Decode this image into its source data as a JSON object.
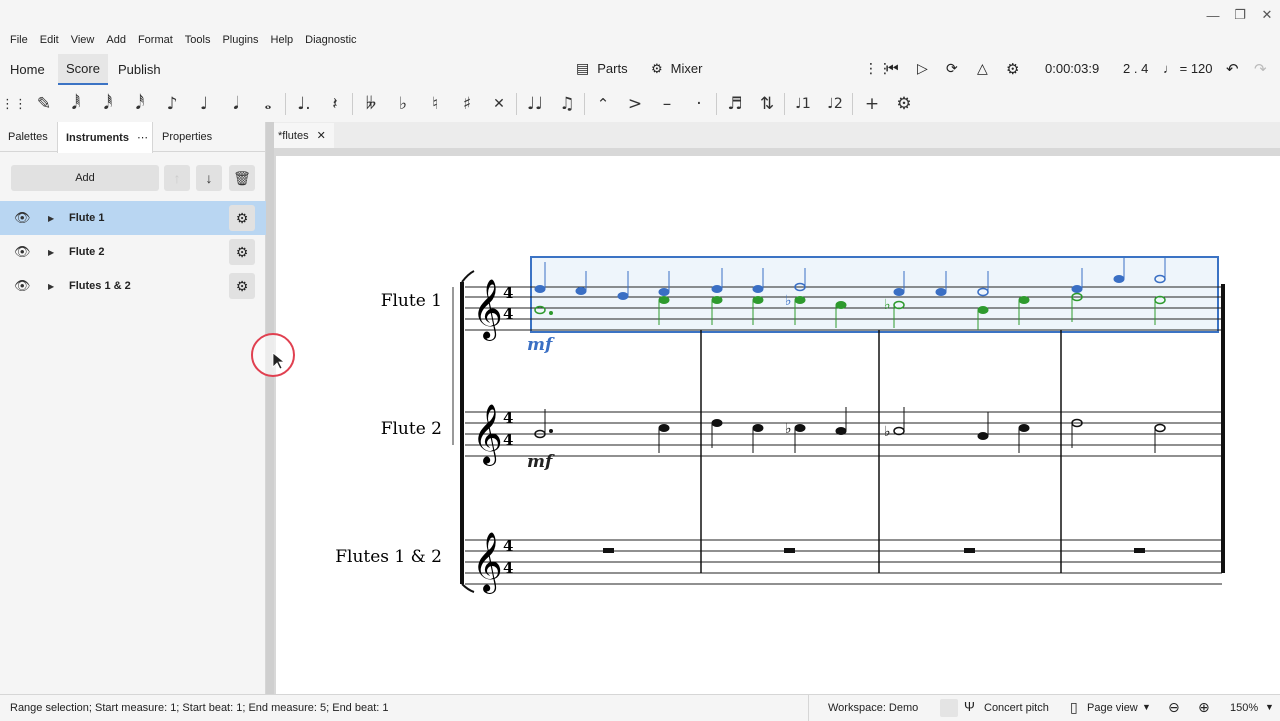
{
  "menu": [
    "File",
    "Edit",
    "View",
    "Add",
    "Format",
    "Tools",
    "Plugins",
    "Help",
    "Diagnostic"
  ],
  "tabs": {
    "home": "Home",
    "score": "Score",
    "publish": "Publish"
  },
  "tabbar": {
    "parts": "Parts",
    "mixer": "Mixer",
    "time": "0:00:03:9",
    "position": "2 . 4",
    "tempo": "♩ = 120"
  },
  "panel": {
    "tabs": {
      "palettes": "Palettes",
      "instruments": "Instruments",
      "properties": "Properties"
    },
    "add": "Add",
    "instruments": [
      {
        "name": "Flute 1",
        "selected": true
      },
      {
        "name": "Flute 2",
        "selected": false
      },
      {
        "name": "Flutes 1 & 2",
        "selected": false
      }
    ]
  },
  "document": {
    "tab": "*flutes"
  },
  "score": {
    "staves": [
      "Flute 1",
      "Flute 2",
      "Flutes 1 & 2"
    ],
    "dynamic": "mf",
    "time_signature": "4/4"
  },
  "status": {
    "selection": "Range selection; Start measure: 1; Start beat: 1; End measure: 5; End beat: 1",
    "workspace": "Workspace: Demo",
    "concert_pitch": "Concert pitch",
    "view_mode": "Page view",
    "zoom": "150%"
  },
  "colors": {
    "accent": "#3b73c4",
    "voice1": "#3a6fc4",
    "voice2": "#2e9a2e",
    "selection_fill": "#eef5fb"
  }
}
